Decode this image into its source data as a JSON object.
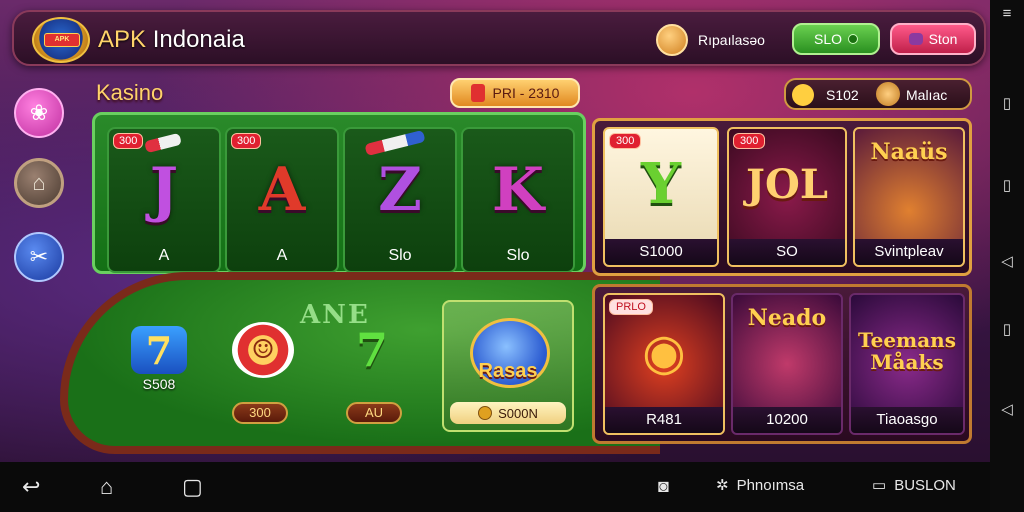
{
  "header": {
    "title_prefix": "APK ",
    "title_main": "Indonaia",
    "logo_text": "APK",
    "user_name": "Rıpaılasəo",
    "btn_green_label": "SLO",
    "btn_pink_label": "Ston"
  },
  "section": {
    "title": "Kasino",
    "promo_label": "PRI - 2310",
    "stat_value": "S102",
    "stat_label": "Malıac"
  },
  "reels": [
    {
      "symbol": "J",
      "label": "A",
      "badge": "300",
      "color": "#c050e0"
    },
    {
      "symbol": "A",
      "label": "A",
      "badge": "300",
      "color": "#e03a2a"
    },
    {
      "symbol": "Z",
      "label": "Slo",
      "badge": "",
      "color": "#b050e0"
    },
    {
      "symbol": "K",
      "label": "Slo",
      "badge": "",
      "color": "#d040c0"
    }
  ],
  "table": {
    "felt_text": "ANE",
    "items": [
      {
        "icon": "7",
        "value": "S508"
      },
      {
        "icon": "☺",
        "value": "300"
      },
      {
        "icon": "7",
        "value": "AU"
      }
    ],
    "jackpot": {
      "name": "Rasas",
      "amount": "S000N"
    }
  },
  "panels": {
    "top": [
      {
        "art": "Y",
        "badge": "300",
        "caption": "S1000"
      },
      {
        "art": "JOL",
        "badge": "300",
        "caption": "SO"
      },
      {
        "art": "Naaüs",
        "badge": "",
        "caption": "Svintpleav"
      }
    ],
    "bottom": [
      {
        "art": "◉",
        "badge": "PRLO",
        "caption": "R481"
      },
      {
        "art": "Neado",
        "badge": "",
        "caption": "10200"
      },
      {
        "art": "Teemans Måaks",
        "badge": "",
        "caption": "Tiaoasgo"
      }
    ]
  },
  "navbar": {
    "item1_label": "Phnoımsa",
    "item2_label": "BUSLON"
  },
  "colors": {
    "accent_gold": "#ffd36a",
    "felt_green": "#1a7018",
    "panel_border": "#e0a040"
  }
}
